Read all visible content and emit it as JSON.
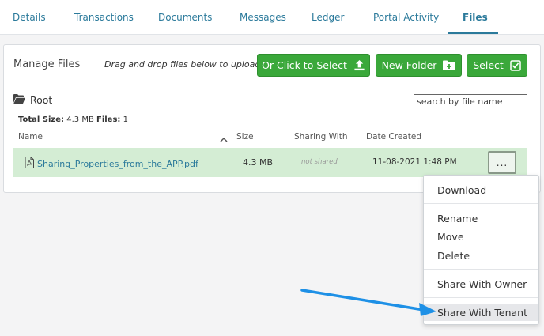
{
  "tabs": [
    {
      "label": "Details"
    },
    {
      "label": "Transactions"
    },
    {
      "label": "Documents"
    },
    {
      "label": "Messages"
    },
    {
      "label": "Ledger"
    },
    {
      "label": "Portal Activity"
    },
    {
      "label": "Files",
      "active": true
    }
  ],
  "panel": {
    "title": "Manage Files",
    "drag_hint": "Drag and drop files below to upload",
    "buttons": {
      "click_to_select": "Or Click to Select",
      "new_folder": "New Folder",
      "select": "Select"
    },
    "folder": "Root",
    "search_placeholder": "search by file name",
    "totals": {
      "size_label": "Total Size:",
      "size_value": "4.3 MB",
      "files_label": "Files:",
      "files_value": "1"
    },
    "columns": {
      "name": "Name",
      "size": "Size",
      "sharing": "Sharing With",
      "date": "Date Created"
    },
    "files": [
      {
        "name": "Sharing_Properties_from_the_APP.pdf",
        "size": "4.3 MB",
        "sharing": "not shared",
        "date": "11-08-2021 1:48 PM",
        "more_label": "..."
      }
    ]
  },
  "context_menu": {
    "items": [
      {
        "label": "Download"
      },
      {
        "label": "Rename"
      },
      {
        "label": "Move"
      },
      {
        "label": "Delete"
      },
      {
        "label": "Share With Owner"
      },
      {
        "label": "Share With Tenant",
        "highlighted": true
      }
    ]
  },
  "colors": {
    "accent": "#2b7a9b",
    "button_green": "#3aa83a",
    "row_highlight": "#d4edd4",
    "annotation_arrow": "#1e90e6"
  }
}
